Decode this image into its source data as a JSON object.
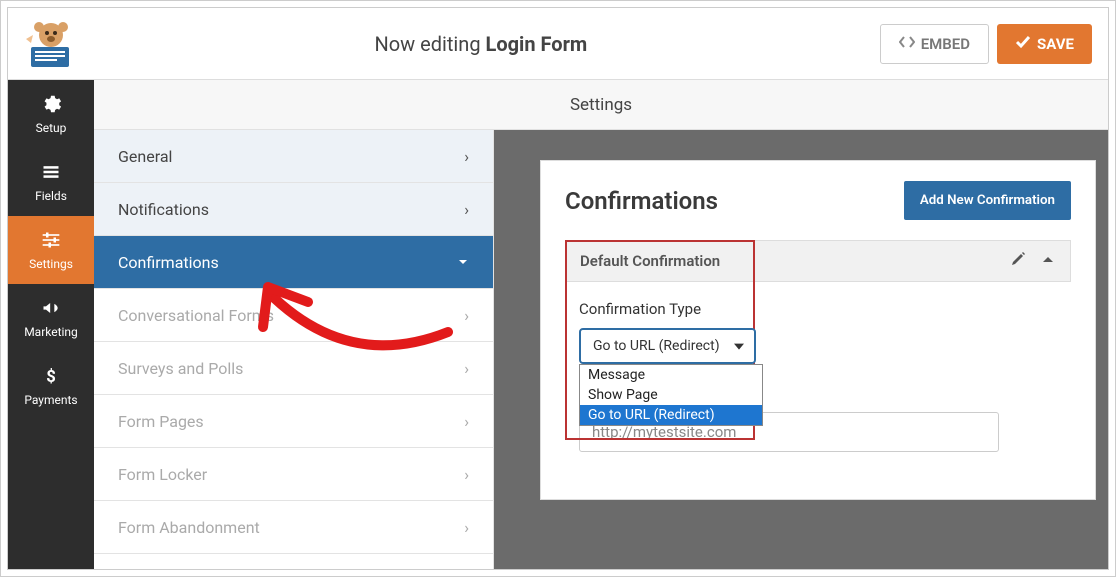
{
  "header": {
    "editing_prefix": "Now editing ",
    "form_name": "Login Form",
    "embed_label": "EMBED",
    "save_label": "SAVE"
  },
  "sidebar": {
    "items": [
      {
        "label": "Setup"
      },
      {
        "label": "Fields"
      },
      {
        "label": "Settings"
      },
      {
        "label": "Marketing"
      },
      {
        "label": "Payments"
      }
    ]
  },
  "settings_header": "Settings",
  "left_menu": [
    {
      "label": "General",
      "style": "light"
    },
    {
      "label": "Notifications",
      "style": "light"
    },
    {
      "label": "Confirmations",
      "style": "active"
    },
    {
      "label": "Conversational Forms",
      "style": "disabled"
    },
    {
      "label": "Surveys and Polls",
      "style": "disabled"
    },
    {
      "label": "Form Pages",
      "style": "disabled"
    },
    {
      "label": "Form Locker",
      "style": "disabled"
    },
    {
      "label": "Form Abandonment",
      "style": "disabled"
    }
  ],
  "panel": {
    "title": "Confirmations",
    "add_button": "Add New Confirmation",
    "default_label": "Default Confirmation",
    "confirmation_type_label": "Confirmation Type",
    "select_value": "Go to URL (Redirect)",
    "options": [
      "Message",
      "Show Page",
      "Go to URL (Redirect)"
    ],
    "url_value": "http://mytestsite.com"
  },
  "colors": {
    "accent": "#e27730",
    "blue": "#2e6da4"
  }
}
